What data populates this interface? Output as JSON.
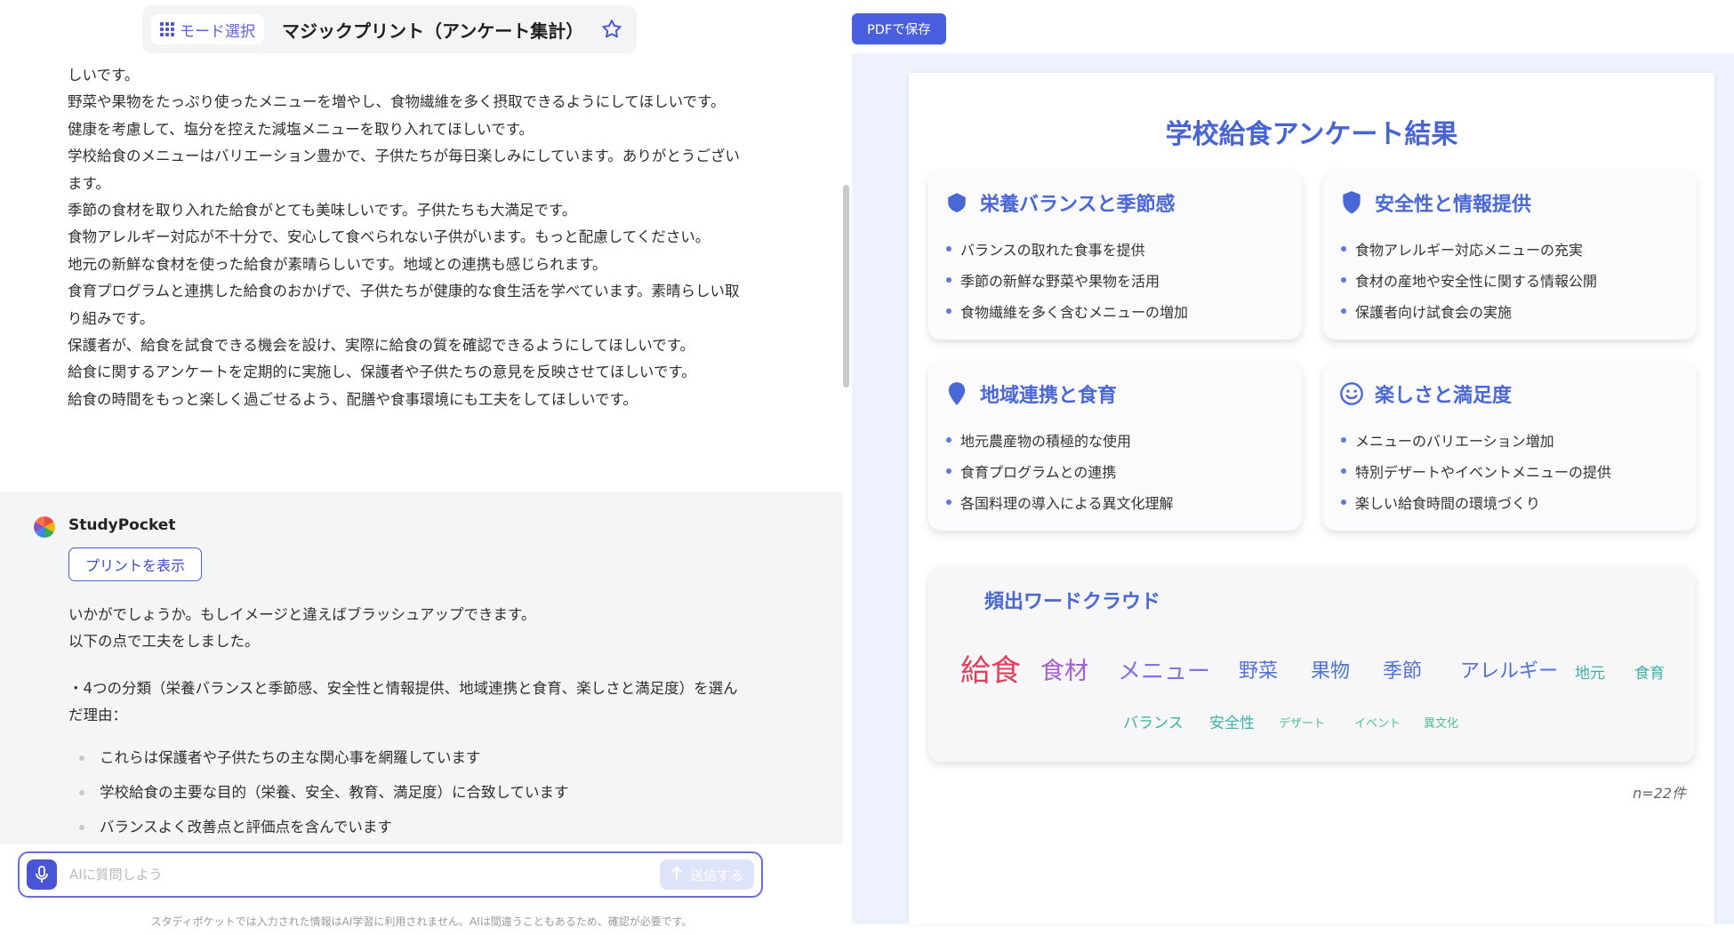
{
  "header": {
    "mode_select_label": "モード選択",
    "title": "マジックプリント（アンケート集計）",
    "star_icon": "star-icon"
  },
  "chat_upper_lines": [
    "しいです。",
    "野菜や果物をたっぷり使ったメニューを増やし、食物繊維を多く摂取できるようにしてほしいです。",
    "健康を考慮して、塩分を控えた減塩メニューを取り入れてほしいです。",
    "学校給食のメニューはバリエーション豊かで、子供たちが毎日楽しみにしています。ありがとうございます。",
    "季節の食材を取り入れた給食がとても美味しいです。子供たちも大満足です。",
    "食物アレルギー対応が不十分で、安心して食べられない子供がいます。もっと配慮してください。",
    "地元の新鮮な食材を使った給食が素晴らしいです。地域との連携も感じられます。",
    "食育プログラムと連携した給食のおかげで、子供たちが健康的な食生活を学べています。素晴らしい取り組みです。",
    "保護者が、給食を試食できる機会を設け、実際に給食の質を確認できるようにしてほしいです。",
    "給食に関するアンケートを定期的に実施し、保護者や子供たちの意見を反映させてほしいです。",
    "給食の時間をもっと楽しく過ごせるよう、配膳や食事環境にも工夫をしてほしいです。"
  ],
  "bot": {
    "name": "StudyPocket",
    "view_print_label": "プリントを表示",
    "intro_lines": [
      "いかがでしょうか。もしイメージと違えばブラッシュアップできます。",
      "以下の点で工夫をしました。"
    ],
    "reason_line": "・4つの分類（栄養バランスと季節感、安全性と情報提供、地域連携と食育、楽しさと満足度）を選んだ理由：",
    "reasons": [
      "これらは保護者や子供たちの主な関心事を網羅しています",
      "学校給食の主要な目的（栄養、安全、教育、満足度）に合致しています",
      "バランスよく改善点と評価点を含んでいます"
    ]
  },
  "input": {
    "placeholder": "AIに質問しよう",
    "send_label": "送信する",
    "disclaimer": "スタディポケットでは入力された情報はAI学習に利用されません。AIは間違うこともあるため、確認が必要です。"
  },
  "preview": {
    "pdf_button_label": "PDFで保存",
    "title": "学校給食アンケート結果",
    "cards": [
      {
        "title": "栄養バランスと季節感",
        "icon": "shield-icon",
        "items": [
          "バランスの取れた食事を提供",
          "季節の新鮮な野菜や果物を活用",
          "食物繊維を多く含むメニューの増加"
        ]
      },
      {
        "title": "安全性と情報提供",
        "icon": "shield-icon",
        "items": [
          "食物アレルギー対応メニューの充実",
          "食材の産地や安全性に関する情報公開",
          "保護者向け試食会の実施"
        ]
      },
      {
        "title": "地域連携と食育",
        "icon": "map-pin-icon",
        "items": [
          "地元農産物の積極的な使用",
          "食育プログラムとの連携",
          "各国料理の導入による異文化理解"
        ]
      },
      {
        "title": "楽しさと満足度",
        "icon": "smile-icon",
        "items": [
          "メニューのバリエーション増加",
          "特別デザートやイベントメニューの提供",
          "楽しい給食時間の環境づくり"
        ]
      }
    ],
    "wordcloud": {
      "title": "頻出ワードクラウド",
      "words": [
        {
          "text": "給食",
          "color": "#e0405a"
        },
        {
          "text": "食材",
          "color": "#a35fd6"
        },
        {
          "text": "メニュー",
          "color": "#8a6fe0"
        },
        {
          "text": "野菜",
          "color": "#4f72d6"
        },
        {
          "text": "果物",
          "color": "#4f72d6"
        },
        {
          "text": "季節",
          "color": "#4f72d6"
        },
        {
          "text": "アレルギー",
          "color": "#4f72d6"
        },
        {
          "text": "地元",
          "color": "#3bb2a5"
        },
        {
          "text": "食育",
          "color": "#3bb2a5"
        },
        {
          "text": "バランス",
          "color": "#3bb2a5"
        },
        {
          "text": "安全性",
          "color": "#3bb2a5"
        },
        {
          "text": "デザート",
          "color": "#4dbf8e"
        },
        {
          "text": "イベント",
          "color": "#4dbf8e"
        },
        {
          "text": "異文化",
          "color": "#4dbf8e"
        }
      ]
    },
    "sample_count": "n=22件"
  }
}
